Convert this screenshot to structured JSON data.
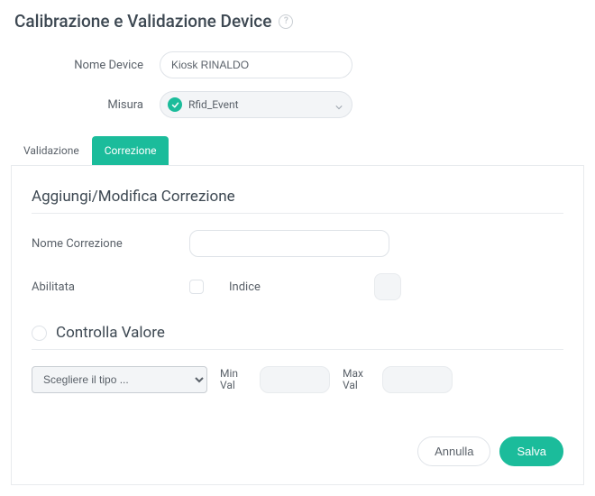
{
  "header": {
    "title": "Calibrazione e Validazione Device"
  },
  "form": {
    "device_label": "Nome Device",
    "device_value": "Kiosk RINALDO",
    "measure_label": "Misura",
    "measure_value": "Rfid_Event"
  },
  "tabs": {
    "validation": "Validazione",
    "correction": "Correzione"
  },
  "correction": {
    "section_title": "Aggiungi/Modifica Correzione",
    "name_label": "Nome Correzione",
    "name_value": "",
    "enabled_label": "Abilitata",
    "index_label": "Indice",
    "check_value_title": "Controlla Valore",
    "type_placeholder": "Scegliere il tipo ...",
    "min_label": "Min Val",
    "max_label": "Max Val"
  },
  "footer": {
    "cancel": "Annulla",
    "save": "Salva"
  }
}
